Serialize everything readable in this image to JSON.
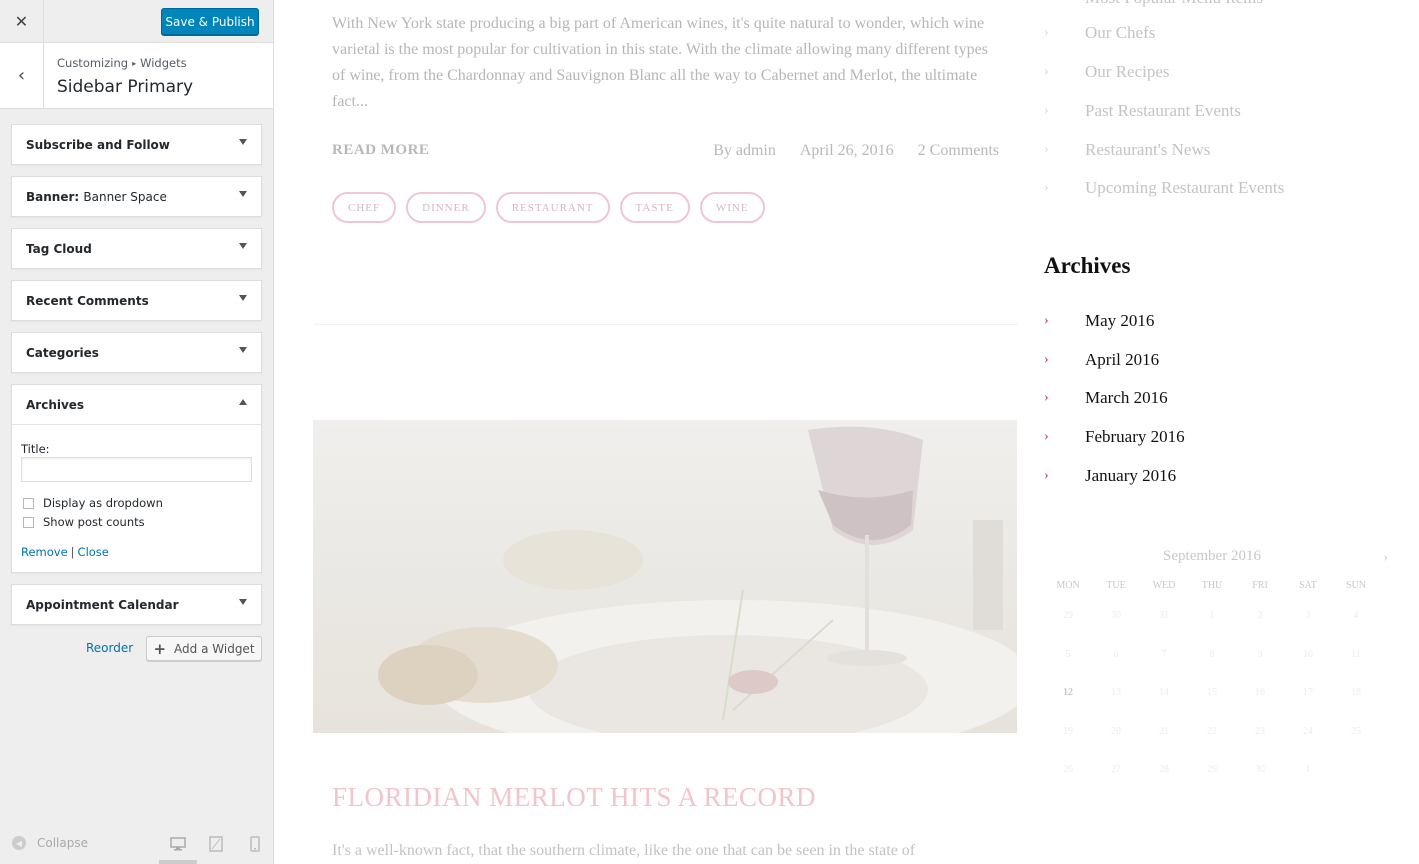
{
  "customizer": {
    "close_icon": "close-icon",
    "save_label": "Save & Publish",
    "breadcrumb": {
      "part1": "Customizing",
      "part2": "Widgets"
    },
    "section_title": "Sidebar Primary",
    "widgets": [
      {
        "title": "Subscribe and Follow"
      },
      {
        "title": "Banner:",
        "subtitle": "Banner Space"
      },
      {
        "title": "Tag Cloud"
      },
      {
        "title": "Recent Comments"
      },
      {
        "title": "Categories"
      },
      {
        "title": "Archives",
        "expanded": true
      },
      {
        "title": "Appointment Calendar"
      }
    ],
    "archives_form": {
      "title_label": "Title:",
      "title_value": "",
      "dropdown_label": "Display as dropdown",
      "dropdown_checked": false,
      "counts_label": "Show post counts",
      "counts_checked": false,
      "remove_label": "Remove",
      "close_label": "Close"
    },
    "reorder_label": "Reorder",
    "add_widget_label": "Add a Widget",
    "collapse_label": "Collapse",
    "preview_device": "desktop"
  },
  "preview": {
    "post1": {
      "excerpt": "With New York state producing a big part of American wines, it's quite natural to wonder, which wine varietal is the most popular for cultivation in this state. With the climate allowing many different types of wine, from the Chardonnay and Sauvignon Blanc all the way to Cabernet and Merlot, the ultimate fact...",
      "read_more": "READ MORE",
      "author": "By admin",
      "date": "April 26, 2016",
      "comments": "2 Comments",
      "tags": [
        "CHEF",
        "DINNER",
        "RESTAURANT",
        "TASTE",
        "WINE"
      ]
    },
    "post2": {
      "title": "FLORIDIAN MERLOT HITS A RECORD",
      "excerpt": "It's a well-known fact, that the southern climate, like the one that can be seen in the state of"
    },
    "sidebar": {
      "categories": [
        "Most Popular Menu Items",
        "Our Chefs",
        "Our Recipes",
        "Past Restaurant Events",
        "Restaurant's News",
        "Upcoming Restaurant Events"
      ],
      "archives_heading": "Archives",
      "archives": [
        "May 2016",
        "April 2016",
        "March 2016",
        "February 2016",
        "January 2016"
      ],
      "calendar": {
        "caption": "September 2016",
        "next": "›",
        "weekdays": [
          "MON",
          "TUE",
          "WED",
          "THU",
          "FRI",
          "SAT",
          "SUN"
        ],
        "days": [
          "29",
          "30",
          "31",
          "1",
          "2",
          "3",
          "4",
          "5",
          "6",
          "7",
          "8",
          "9",
          "10",
          "11",
          "12",
          "13",
          "14",
          "15",
          "16",
          "17",
          "18",
          "19",
          "20",
          "21",
          "22",
          "23",
          "24",
          "25",
          "26",
          "27",
          "28",
          "29",
          "30",
          "1",
          ""
        ],
        "today": "12"
      }
    },
    "colors": {
      "accent": "#c0355a",
      "tag_border": "#f2c6d0",
      "publish_blue": "#0085ba"
    }
  }
}
